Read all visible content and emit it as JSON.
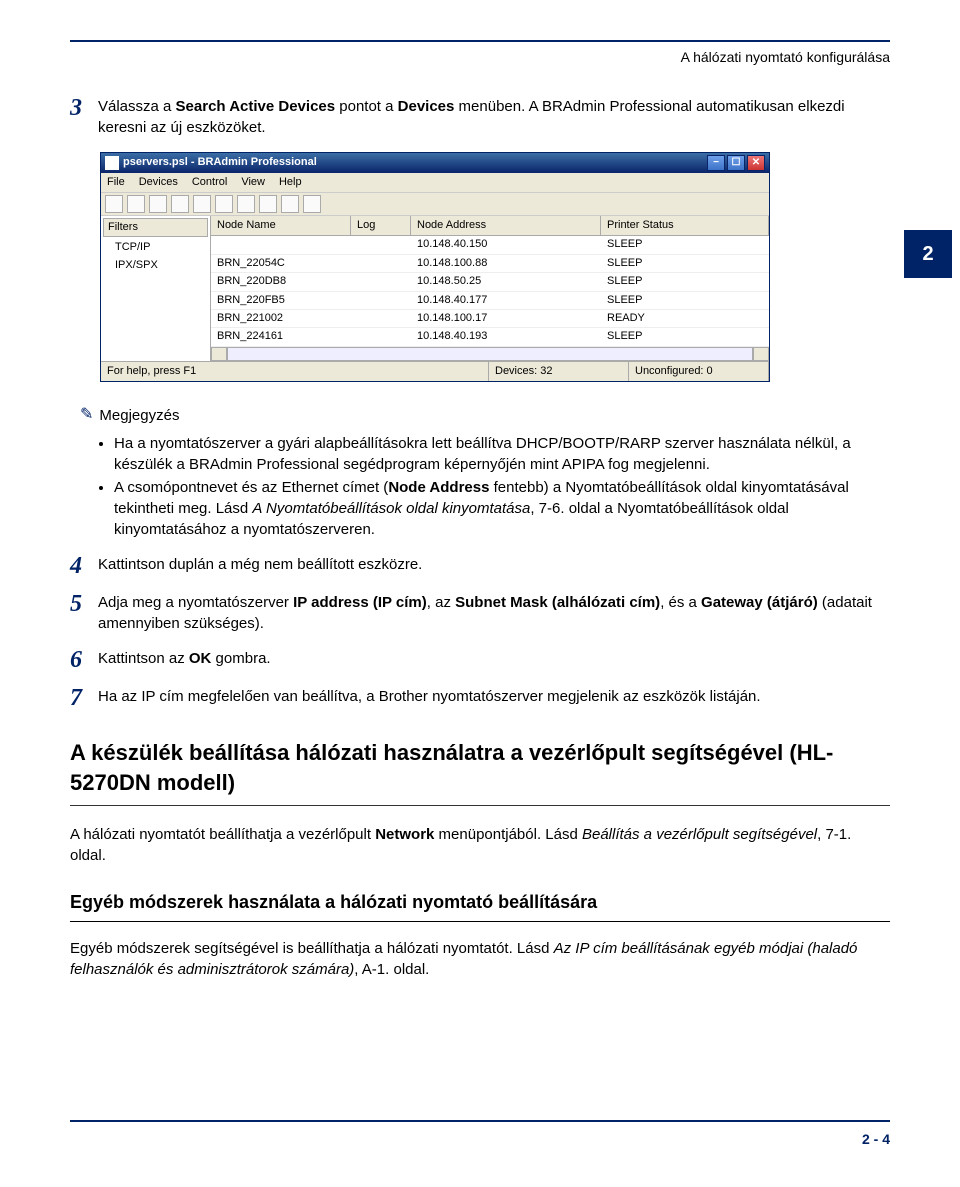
{
  "header_right": "A hálózati nyomtató konfigurálása",
  "tab_badge": "2",
  "page_number": "2 - 4",
  "screenshot": {
    "title": "pservers.psl - BRAdmin Professional",
    "menus": [
      "File",
      "Devices",
      "Control",
      "View",
      "Help"
    ],
    "filters_header": "Filters",
    "filters": [
      "TCP/IP",
      "IPX/SPX"
    ],
    "columns": {
      "name": "Node Name",
      "log": "Log",
      "addr": "Node Address",
      "stat": "Printer Status"
    },
    "rows": [
      {
        "name": "",
        "log": "",
        "addr": "10.148.40.150",
        "stat": "SLEEP"
      },
      {
        "name": "BRN_22054C",
        "log": "",
        "addr": "10.148.100.88",
        "stat": "SLEEP"
      },
      {
        "name": "BRN_220DB8",
        "log": "",
        "addr": "10.148.50.25",
        "stat": "SLEEP"
      },
      {
        "name": "BRN_220FB5",
        "log": "",
        "addr": "10.148.40.177",
        "stat": "SLEEP"
      },
      {
        "name": "BRN_221002",
        "log": "",
        "addr": "10.148.100.17",
        "stat": "READY"
      },
      {
        "name": "BRN_224161",
        "log": "",
        "addr": "10.148.40.193",
        "stat": "SLEEP"
      }
    ],
    "status": {
      "help": "For help, press F1",
      "devices": "Devices: 32",
      "unconf": "Unconfigured: 0"
    }
  },
  "steps": {
    "s3_pre": "Válassza a ",
    "s3_b1": "Search Active Devices",
    "s3_mid": " pontot a ",
    "s3_b2": "Devices",
    "s3_post": " menüben. A BRAdmin Professional automatikusan elkezdi keresni az új eszközöket.",
    "s4": "Kattintson duplán a még nem beállított eszközre.",
    "s5_pre": "Adja meg a nyomtatószerver ",
    "s5_b1": "IP address (IP cím)",
    "s5_mid1": ", az ",
    "s5_b2": "Subnet Mask (alhálózati cím)",
    "s5_mid2": ", és a ",
    "s5_b3": "Gateway (átjáró)",
    "s5_post": " (adatait amennyiben szükséges).",
    "s6_pre": "Kattintson az ",
    "s6_b": "OK",
    "s6_post": " gombra.",
    "s7": "Ha az IP cím megfelelően van beállítva, a Brother nyomtatószerver megjelenik az eszközök listáján."
  },
  "note": {
    "title": "Megjegyzés",
    "li1": "Ha a nyomtatószerver a gyári alapbeállításokra lett beállítva DHCP/BOOTP/RARP szerver használata nélkül, a készülék a BRAdmin Professional segédprogram képernyőjén mint APIPA fog megjelenni.",
    "li2_pre": "A csomópontnevet és az Ethernet címet (",
    "li2_b1": "Node Address",
    "li2_mid1": " fentebb) a Nyomtatóbeállítások oldal kinyomtatásával tekintheti meg. Lásd ",
    "li2_i1": "A Nyomtatóbeállítások oldal kinyomtatása",
    "li2_mid2": ", 7-6. oldal a Nyomtatóbeállítások oldal kinyomtatásához a nyomtatószerveren."
  },
  "h2": "A készülék beállítása hálózati használatra a vezérlőpult segítségével (HL-5270DN modell)",
  "para1_pre": "A hálózati nyomtatót beállíthatja a vezérlőpult ",
  "para1_b": "Network",
  "para1_mid": " menüpontjából. Lásd ",
  "para1_i": "Beállítás a vezérlőpult segítségével",
  "para1_post": ", 7-1. oldal.",
  "h3": "Egyéb módszerek használata a hálózati nyomtató beállítására",
  "para2_pre": "Egyéb módszerek segítségével is beállíthatja a hálózati nyomtatót. Lásd ",
  "para2_i": "Az IP cím beállításának egyéb módjai (haladó felhasználók és adminisztrátorok számára)",
  "para2_post": ", A-1. oldal."
}
